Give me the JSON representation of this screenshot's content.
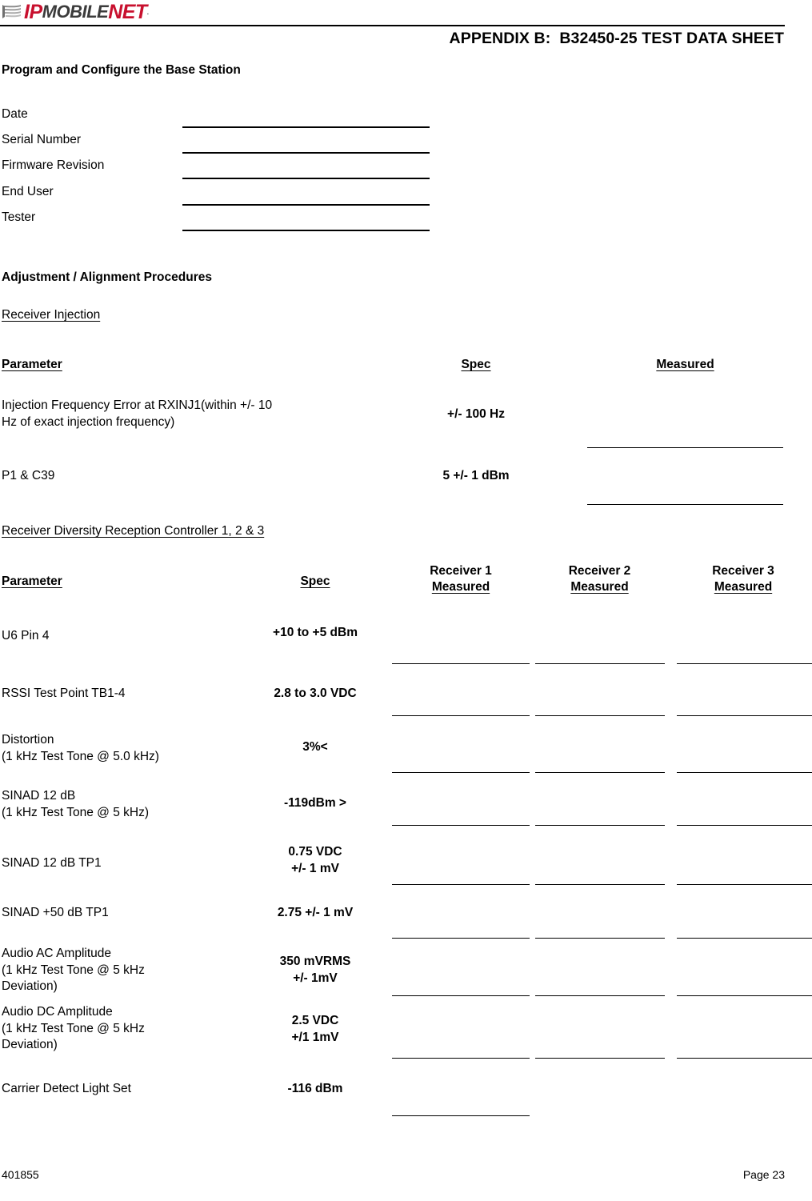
{
  "header": {
    "logo": {
      "part1": "IP",
      "part2": "MOBILE",
      "part3": "NET",
      "tm": ".",
      "color_red": "#c8102e",
      "color_dark": "#3b3b3b"
    },
    "appendix_title": "APPENDIX B:  B32450-25 TEST DATA SHEET"
  },
  "sections": {
    "program_configure": "Program and Configure the Base Station",
    "adjustment": "Adjustment / Alignment Procedures",
    "receiver_injection": "Receiver Injection",
    "receiver_diversity": "Receiver Diversity Reception Controller 1, 2 & 3"
  },
  "identification_fields": [
    {
      "label": "Date",
      "value": ""
    },
    {
      "label": "Serial Number",
      "value": ""
    },
    {
      "label": "Firmware Revision",
      "value": ""
    },
    {
      "label": "End User",
      "value": ""
    },
    {
      "label": "Tester",
      "value": ""
    }
  ],
  "table1": {
    "headers": {
      "parameter": "Parameter",
      "spec": "Spec",
      "measured": "Measured"
    },
    "rows": [
      {
        "parameter": "Injection Frequency Error at RXINJ1(within +/- 10\nHz of exact injection frequency)",
        "spec": "+/- 100 Hz",
        "measured": ""
      },
      {
        "parameter": "P1 & C39",
        "spec": "5 +/- 1 dBm",
        "measured": ""
      }
    ]
  },
  "table2": {
    "headers": {
      "parameter": "Parameter",
      "spec": "Spec",
      "receiver1_line1": "Receiver 1",
      "receiver1_line2": "Measured",
      "receiver2_line1": "Receiver 2",
      "receiver2_line2": "Measured",
      "receiver3_line1": "Receiver 3",
      "receiver3_line2": "Measured"
    },
    "rows": [
      {
        "parameter": "U6 Pin 4",
        "spec": "+10 to +5 dBm",
        "r1": "",
        "r2": "",
        "r3": ""
      },
      {
        "parameter": "RSSI Test Point TB1-4",
        "spec": "2.8 to 3.0 VDC",
        "r1": "",
        "r2": "",
        "r3": ""
      },
      {
        "parameter": "Distortion\n(1 kHz Test Tone @ 5.0 kHz)",
        "spec": "3%<",
        "r1": "",
        "r2": "",
        "r3": ""
      },
      {
        "parameter": "SINAD 12 dB\n(1 kHz Test Tone @ 5 kHz)",
        "spec": "-119dBm >",
        "r1": "",
        "r2": "",
        "r3": ""
      },
      {
        "parameter": "SINAD 12 dB TP1",
        "spec": "0.75 VDC\n+/- 1 mV",
        "r1": "",
        "r2": "",
        "r3": ""
      },
      {
        "parameter": "SINAD +50 dB TP1",
        "spec": "2.75 +/- 1 mV",
        "r1": "",
        "r2": "",
        "r3": ""
      },
      {
        "parameter": "Audio AC Amplitude\n(1 kHz Test Tone @ 5 kHz\nDeviation)",
        "spec": "350 mVRMS\n+/- 1mV",
        "r1": "",
        "r2": "",
        "r3": ""
      },
      {
        "parameter": "Audio DC Amplitude\n(1 kHz Test Tone @ 5 kHz\nDeviation)",
        "spec": "2.5 VDC\n+/1 1mV",
        "r1": "",
        "r2": "",
        "r3": ""
      },
      {
        "parameter": "Carrier Detect Light Set",
        "spec": "-116 dBm",
        "r1": "",
        "r2": "",
        "r3": ""
      }
    ]
  },
  "footer": {
    "doc_number": "401855",
    "page": "Page 23"
  }
}
